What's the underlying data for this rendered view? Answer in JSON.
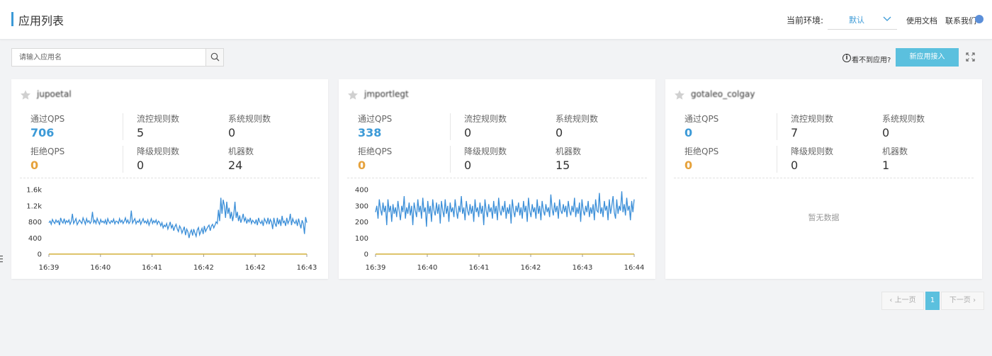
{
  "header": {
    "title": "应用列表",
    "env_label": "当前环境:",
    "env_value": "默认",
    "docs_link": "使用文档",
    "contact_link": "联系我们"
  },
  "toolbar": {
    "search_placeholder": "请输入应用名",
    "help_text": "看不到应用?",
    "new_app_button": "新应用接入"
  },
  "colors": {
    "accent": "#3c9ad7",
    "button": "#5bc0de",
    "block_qps": "#e6a23c",
    "chart_line": "#3c8fd8",
    "chart_zero_line": "#d4b13a"
  },
  "cards": [
    {
      "name": "jupoetal",
      "pass_qps_label": "通过QPS",
      "pass_qps": "706",
      "flow_rules_label": "流控规则数",
      "flow_rules": "5",
      "system_rules_label": "系统规则数",
      "system_rules": "0",
      "block_qps_label": "拒绝QPS",
      "block_qps": "0",
      "degrade_rules_label": "降级规则数",
      "degrade_rules": "0",
      "machines_label": "机器数",
      "machines": "24"
    },
    {
      "name": "jmportlegt",
      "pass_qps_label": "通过QPS",
      "pass_qps": "338",
      "flow_rules_label": "流控规则数",
      "flow_rules": "0",
      "system_rules_label": "系统规则数",
      "system_rules": "0",
      "block_qps_label": "拒绝QPS",
      "block_qps": "0",
      "degrade_rules_label": "降级规则数",
      "degrade_rules": "0",
      "machines_label": "机器数",
      "machines": "15"
    },
    {
      "name": "gotaleo_colgay",
      "pass_qps_label": "通过QPS",
      "pass_qps": "0",
      "flow_rules_label": "流控规则数",
      "flow_rules": "7",
      "system_rules_label": "系统规则数",
      "system_rules": "0",
      "block_qps_label": "拒绝QPS",
      "block_qps": "0",
      "degrade_rules_label": "降级规则数",
      "degrade_rules": "0",
      "machines_label": "机器数",
      "machines": "1",
      "no_data_text": "暂无数据"
    }
  ],
  "chart_data": [
    {
      "type": "line",
      "x_ticks": [
        "16:39",
        "16:40",
        "16:41",
        "16:42",
        "16:42",
        "16:43"
      ],
      "y_ticks": [
        "0",
        "400",
        "800",
        "1.2k",
        "1.6k"
      ],
      "ylim": [
        0,
        1600
      ],
      "series": [
        {
          "values": [
            780,
            820,
            740,
            860,
            800,
            760,
            850,
            790,
            830,
            720,
            900,
            810,
            770,
            880,
            760,
            830,
            790,
            850,
            740,
            810,
            1000,
            760,
            820,
            880,
            730,
            790,
            850,
            800,
            760,
            900,
            820,
            740,
            880,
            790,
            830,
            760,
            810,
            1050,
            780,
            840,
            760,
            890,
            800,
            740,
            860,
            790,
            820,
            770,
            850,
            730,
            880,
            800,
            760,
            830,
            790,
            870,
            750,
            820,
            810,
            760,
            880,
            790,
            840,
            760,
            820,
            900,
            780,
            850,
            760,
            810,
            1080,
            770,
            830,
            880,
            750,
            820,
            790,
            860,
            740,
            810,
            880,
            780,
            820,
            760,
            850,
            720,
            800,
            880,
            760,
            830,
            780,
            850,
            740,
            820,
            790,
            700,
            780,
            650,
            720,
            680,
            760,
            620,
            700,
            800,
            650,
            720,
            580,
            680,
            740,
            620,
            560,
            700,
            640,
            520,
            600,
            680,
            470,
            620,
            560,
            400,
            540,
            600,
            460,
            620,
            520,
            440,
            600,
            660,
            480,
            560,
            640,
            500,
            700,
            560,
            620,
            680,
            720,
            580,
            700,
            740,
            650,
            720,
            800,
            760,
            1100,
            820,
            1400,
            1000,
            1350,
            1200,
            900,
            1300,
            1000,
            1150,
            880,
            1050,
            820,
            980,
            1300,
            900,
            1050,
            820,
            960,
            780,
            880,
            1000,
            820,
            900,
            760,
            860,
            800,
            900,
            760,
            840,
            800,
            760,
            860,
            720,
            900,
            800,
            760,
            830,
            700,
            880,
            820,
            760,
            900,
            740,
            860,
            800,
            620,
            900,
            760,
            680,
            900,
            740,
            860,
            700,
            950,
            780,
            820,
            700,
            900,
            760,
            830,
            1000,
            720,
            880,
            800,
            760,
            840,
            700,
            880,
            760,
            640,
            840,
            760,
            500,
            920,
            780
          ]
        },
        {
          "values": [
            0,
            0
          ]
        }
      ]
    },
    {
      "type": "line",
      "x_ticks": [
        "16:39",
        "16:40",
        "16:41",
        "16:42",
        "16:43",
        "16:44"
      ],
      "y_ticks": [
        "0",
        "100",
        "200",
        "300",
        "400"
      ],
      "ylim": [
        0,
        400
      ],
      "series": [
        {
          "values": [
            260,
            300,
            220,
            340,
            280,
            240,
            320,
            260,
            300,
            180,
            340,
            260,
            300,
            200,
            310,
            250,
            290,
            230,
            330,
            270,
            210,
            300,
            260,
            360,
            220,
            290,
            250,
            320,
            240,
            300,
            180,
            320,
            270,
            230,
            340,
            260,
            300,
            220,
            350,
            260,
            290,
            170,
            330,
            250,
            300,
            200,
            340,
            270,
            240,
            320,
            250,
            310,
            190,
            330,
            270,
            230,
            340,
            250,
            300,
            200,
            320,
            260,
            290,
            230,
            340,
            270,
            220,
            300,
            260,
            360,
            250,
            290,
            210,
            330,
            270,
            240,
            310,
            250,
            300,
            200,
            340,
            260,
            290,
            230,
            320,
            250,
            300,
            180,
            340,
            270,
            230,
            310,
            260,
            290,
            220,
            330,
            250,
            300,
            210,
            350,
            270,
            240,
            300,
            260,
            330,
            220,
            290,
            250,
            310,
            190,
            340,
            270,
            230,
            300,
            260,
            320,
            240,
            290,
            220,
            330,
            260,
            300,
            200,
            350,
            270,
            230,
            310,
            260,
            290,
            220,
            340,
            250,
            300,
            210,
            330,
            270,
            240,
            310,
            260,
            290,
            230,
            370,
            280,
            240,
            320,
            260,
            300,
            220,
            340,
            270,
            250,
            310,
            260,
            300,
            230,
            330,
            270,
            240,
            300,
            260,
            350,
            230,
            290,
            250,
            320,
            200,
            340,
            270,
            240,
            300,
            260,
            330,
            230,
            290,
            250,
            310,
            210,
            340,
            270,
            260,
            380,
            250,
            290,
            230,
            330,
            270,
            300,
            210,
            340,
            250,
            300,
            360,
            260,
            220,
            340,
            250,
            300,
            270,
            390,
            260,
            310,
            240,
            350,
            270,
            300,
            210,
            330,
            260,
            340
          ]
        },
        {
          "values": [
            0,
            0
          ]
        }
      ]
    }
  ],
  "pagination": {
    "prev_label": "上一页",
    "current_page": "1",
    "next_label": "下一页"
  }
}
